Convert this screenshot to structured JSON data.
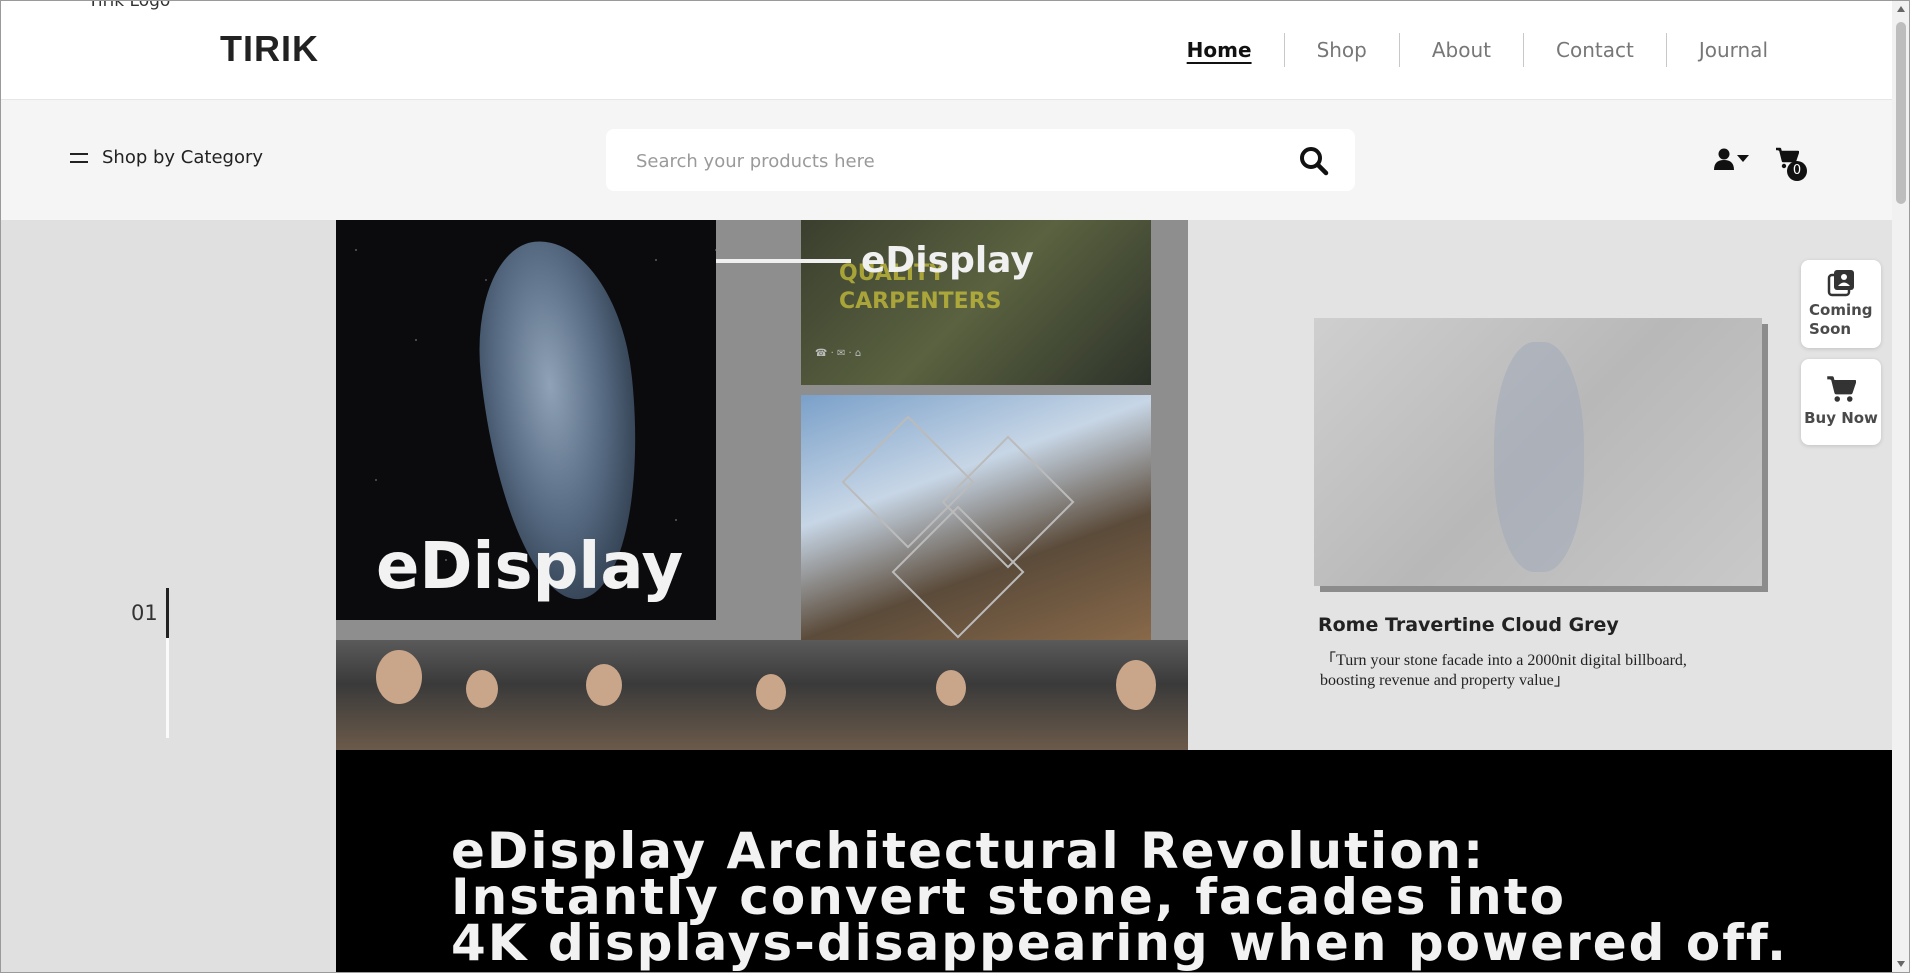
{
  "header": {
    "logo_alt": "Tirik Logo",
    "logo": "TIRIK",
    "nav": [
      "Home",
      "Shop",
      "About",
      "Contact",
      "Journal"
    ]
  },
  "toolbar": {
    "category_label": "Shop by Category",
    "search_placeholder": "Search your products here",
    "cart_count": "0"
  },
  "hero": {
    "slide_number": "01",
    "image_word_large": "eDisplay",
    "image_word_tag": "eDisplay",
    "image_panel_text_1": "QUALITY",
    "image_panel_text_2": "CARPENTERS"
  },
  "product": {
    "name": "Rome Travertine Cloud Grey",
    "description": "「Turn your stone facade into a 2000nit digital billboard, boosting revenue and property value」"
  },
  "floating": {
    "coming_soon": "Coming Soon",
    "buy_now": "Buy Now"
  },
  "headline": {
    "line1": "eDisplay Architectural Revolution:",
    "line2": "Instantly convert stone, facades into",
    "line3": "4K displays-disappearing when powered off."
  },
  "colors": {
    "accent": "#111111",
    "band": "#000000",
    "rail": "#e0e0e0"
  }
}
